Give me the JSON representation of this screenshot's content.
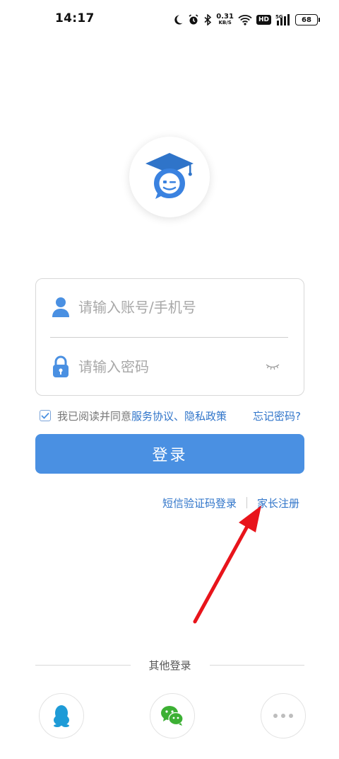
{
  "status_bar": {
    "time": "14:17",
    "net_speed_value": "0.31",
    "net_speed_unit": "KB/S",
    "hd": "HD",
    "signal_label": "5G",
    "battery": "68"
  },
  "login_form": {
    "account_placeholder": "请输入账号/手机号",
    "password_placeholder": "请输入密码"
  },
  "agreement": {
    "prefix": "我已阅读并同意",
    "link": "服务协议、隐私政策",
    "checked": true,
    "forgot_password": "忘记密码?"
  },
  "login_button": "登录",
  "secondary_links": {
    "sms_login": "短信验证码登录",
    "parent_register": "家长注册"
  },
  "other_login": {
    "label": "其他登录",
    "providers": [
      "qq-icon",
      "wechat-icon",
      "more-icon"
    ]
  },
  "colors": {
    "accent": "#4a90e2",
    "link": "#2f74c9",
    "annotation_arrow": "#e8141b"
  }
}
